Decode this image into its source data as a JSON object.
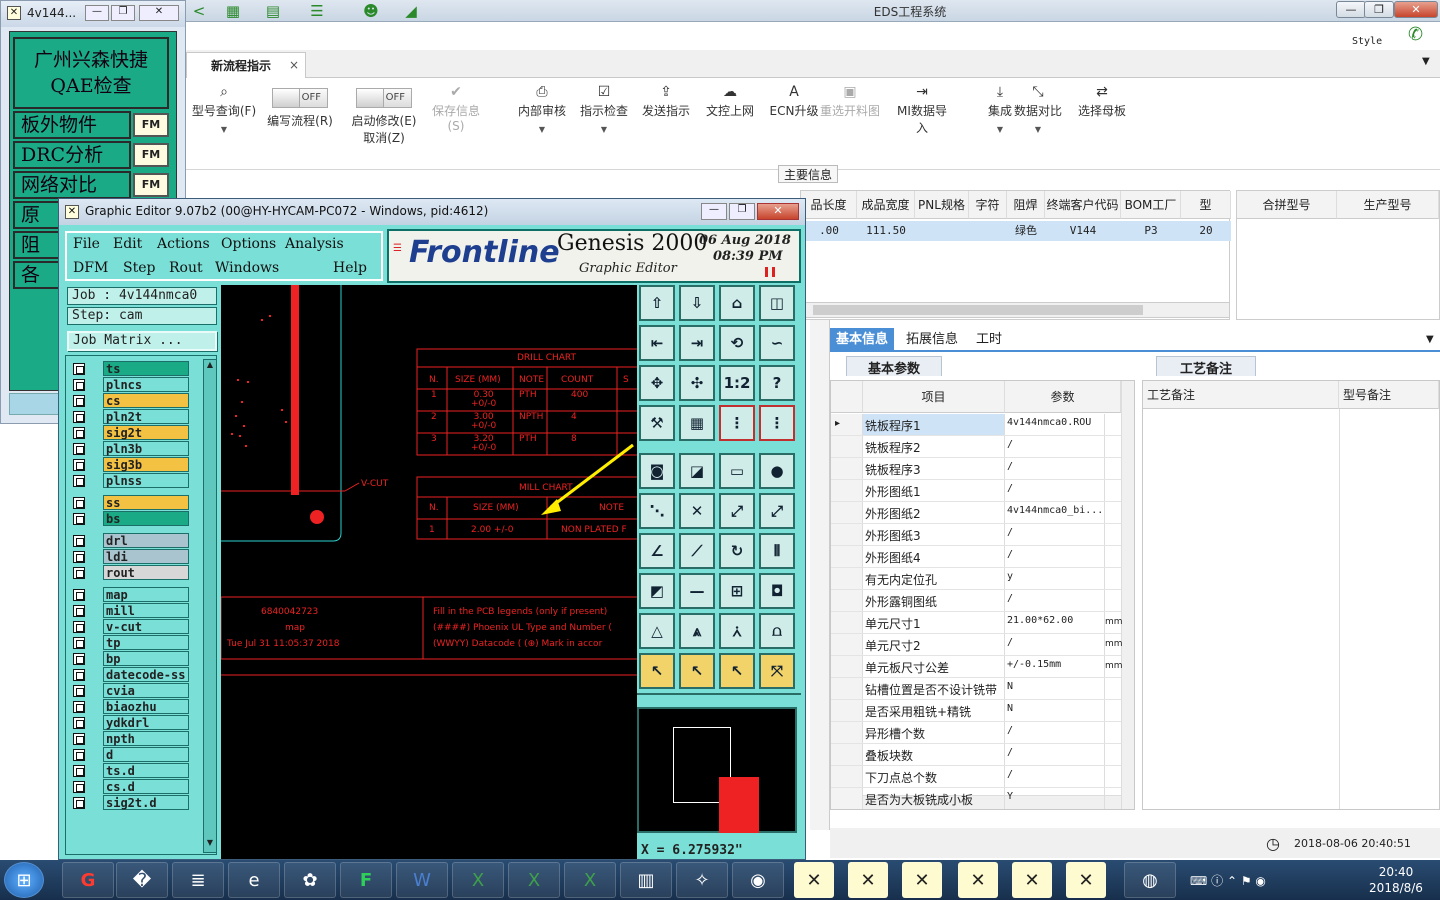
{
  "eds": {
    "title": "EDS工程系统",
    "style_label": "Style",
    "tab_label": "新流程指示",
    "tab_close": "×",
    "ribbon": [
      {
        "icon": "search-icon",
        "glyph": "⌕",
        "label": "型号查询(F)",
        "dim": false
      },
      {
        "icon": "toggle-off",
        "toggle": "OFF",
        "label": "编写流程(R)",
        "dim": false
      },
      {
        "icon": "toggle-off",
        "toggle": "OFF",
        "label": "启动修改(E)\n取消(Z)",
        "dim": false
      },
      {
        "icon": "check-icon",
        "glyph": "✔",
        "label": "保存信息(S)",
        "dim": true
      },
      {
        "icon": "print-icon",
        "glyph": "⎙",
        "label": "内部审核",
        "dim": false
      },
      {
        "icon": "checkbox-icon",
        "glyph": "☑",
        "label": "指示检查",
        "dim": false
      },
      {
        "icon": "upload-icon",
        "glyph": "⇪",
        "label": "发送指示",
        "dim": false
      },
      {
        "icon": "cloud-upload-icon",
        "glyph": "☁",
        "label": "文控上网",
        "dim": false
      },
      {
        "icon": "letter-a-icon",
        "glyph": "A",
        "label": "ECN升级",
        "dim": false
      },
      {
        "icon": "image-icon",
        "glyph": "▣",
        "label": "重选开料图",
        "dim": true
      },
      {
        "icon": "import-icon",
        "glyph": "⇥",
        "label": "MI数据导入",
        "dim": false
      },
      {
        "icon": "download-icon",
        "glyph": "⤓",
        "label": "集成",
        "dim": false
      },
      {
        "icon": "compare-icon",
        "glyph": "⤡",
        "label": "数据对比",
        "dim": false
      },
      {
        "icon": "shuffle-icon",
        "glyph": "⇄",
        "label": "选择母板",
        "dim": false
      }
    ],
    "main_info_label": "主要信息",
    "grid1": {
      "headers": [
        "品长度",
        "成品宽度",
        "PNL规格",
        "字符",
        "阻焊",
        "终端客户代码",
        "BOM工厂",
        "型"
      ],
      "row": [
        ".00",
        "111.50",
        "",
        "",
        "绿色",
        "V144",
        "P3",
        "20"
      ]
    },
    "grid2_headers": [
      "合拼型号",
      "生产型号"
    ],
    "lower_tabs": [
      "基本信息",
      "拓展信息",
      "工时"
    ],
    "basic_params_tab": "基本参数",
    "craft_notes_tab": "工艺备注",
    "param_headers": [
      "项目",
      "参数"
    ],
    "params": [
      {
        "item": "铣板程序1",
        "value": "4v144nmca0.ROU",
        "unit": ""
      },
      {
        "item": "铣板程序2",
        "value": "/",
        "unit": ""
      },
      {
        "item": "铣板程序3",
        "value": "/",
        "unit": ""
      },
      {
        "item": "外形图纸1",
        "value": "/",
        "unit": ""
      },
      {
        "item": "外形图纸2",
        "value": "4v144nmca0_bi...",
        "unit": ""
      },
      {
        "item": "外形图纸3",
        "value": "/",
        "unit": ""
      },
      {
        "item": "外形图纸4",
        "value": "/",
        "unit": ""
      },
      {
        "item": "有无内定位孔",
        "value": "y",
        "unit": ""
      },
      {
        "item": "外形露铜图纸",
        "value": "/",
        "unit": ""
      },
      {
        "item": "单元尺寸1",
        "value": "21.00*62.00",
        "unit": "mm"
      },
      {
        "item": "单元尺寸2",
        "value": "/",
        "unit": "mm"
      },
      {
        "item": "单元板尺寸公差",
        "value": "+/-0.15mm",
        "unit": "mm"
      },
      {
        "item": "钻槽位置是否不设计铣带",
        "value": "N",
        "unit": ""
      },
      {
        "item": "是否采用粗铣+精铣",
        "value": "N",
        "unit": ""
      },
      {
        "item": "异形槽个数",
        "value": "/",
        "unit": ""
      },
      {
        "item": "叠板块数",
        "value": "/",
        "unit": ""
      },
      {
        "item": "下刀点总个数",
        "value": "/",
        "unit": ""
      },
      {
        "item": "是否为大板铣成小板",
        "value": "Y",
        "unit": ""
      }
    ],
    "memo_headers": [
      "工艺备注",
      "型号备注"
    ],
    "status_time": "2018-08-06 20:40:51"
  },
  "qae": {
    "title": "4v144...",
    "heading": "广州兴森快捷\nQAE检查",
    "buttons": [
      {
        "label": "板外物件",
        "fm": "FM"
      },
      {
        "label": "DRC分析",
        "fm": "FM"
      },
      {
        "label": "网络对比",
        "fm": "FM"
      },
      {
        "label": "原",
        "fm": ""
      },
      {
        "label": "阻",
        "fm": ""
      },
      {
        "label": "各",
        "fm": ""
      }
    ]
  },
  "genesis": {
    "title": "Graphic Editor 9.07b2 (00@HY-HYCAM-PC072 - Windows, pid:4612)",
    "menu_row1": [
      "File",
      "Edit",
      "Actions",
      "Options",
      "Analysis"
    ],
    "menu_row2": [
      "DFM",
      "Step",
      "Rout",
      "Windows",
      "Help"
    ],
    "brand": "Frontline",
    "product": "Genesis 2000",
    "subtitle": "Graphic Editor",
    "date": "06 Aug 2018",
    "time": "08:39 PM",
    "job": "Job : 4v144nmca0",
    "step": "Step: cam",
    "job_matrix": "Job Matrix ...",
    "layers": [
      {
        "name": "ts",
        "color": "#1aaa86"
      },
      {
        "name": "plncs",
        "color": "#7adfd6"
      },
      {
        "name": "cs",
        "color": "#f4c242"
      },
      {
        "name": "pln2t",
        "color": "#7adfd6"
      },
      {
        "name": "sig2t",
        "color": "#f4c242"
      },
      {
        "name": "pln3b",
        "color": "#7adfd6"
      },
      {
        "name": "sig3b",
        "color": "#f4c242"
      },
      {
        "name": "plnss",
        "color": "#7adfd6"
      },
      {
        "name": "ss",
        "color": "#f4c242"
      },
      {
        "name": "bs",
        "color": "#1aaa86"
      },
      {
        "name": "drl",
        "color": "#a9c4cf"
      },
      {
        "name": "ldi",
        "color": "#a9c4cf"
      },
      {
        "name": "rout",
        "color": "#d7d7d7"
      },
      {
        "name": "map",
        "color": "#7adfd6"
      },
      {
        "name": "mill",
        "color": "#7adfd6"
      },
      {
        "name": "v-cut",
        "color": "#7adfd6"
      },
      {
        "name": "tp",
        "color": "#7adfd6"
      },
      {
        "name": "bp",
        "color": "#7adfd6"
      },
      {
        "name": "datecode-ss",
        "color": "#7adfd6"
      },
      {
        "name": "cvia",
        "color": "#7adfd6"
      },
      {
        "name": "biaozhu",
        "color": "#7adfd6"
      },
      {
        "name": "ydkdrl",
        "color": "#7adfd6"
      },
      {
        "name": "npth",
        "color": "#7adfd6"
      },
      {
        "name": "d",
        "color": "#7adfd6"
      },
      {
        "name": "ts.d",
        "color": "#7adfd6"
      },
      {
        "name": "cs.d",
        "color": "#7adfd6"
      },
      {
        "name": "sig2t.d",
        "color": "#7adfd6"
      }
    ],
    "canvas": {
      "drill_chart_title": "DRILL CHART",
      "drill_headers": [
        "N.",
        "SIZE (MM)",
        "NOTE",
        "COUNT",
        "S"
      ],
      "drill_rows": [
        [
          "1",
          "0.30\n+0/-0",
          "PTH",
          "400"
        ],
        [
          "2",
          "3.00\n+0/-0",
          "NPTH",
          "4"
        ],
        [
          "3",
          "3.20\n+0/-0",
          "PTH",
          "8"
        ]
      ],
      "mill_chart_title": "MILL CHART",
      "mill_headers": [
        "N.",
        "SIZE (MM)",
        "NOTE"
      ],
      "mill_row": [
        "1",
        "2.00 +/-0",
        "NON PLATED F"
      ],
      "vcut_label": "V-CUT",
      "ref_number": "6840042723",
      "ref_layer": "map",
      "ref_date": "Tue Jul 31 11:05:37 2018",
      "legend_note1": "Fill in the PCB legends (only if present)",
      "legend_note2": "(####) Phoenix UL Type and Number (",
      "legend_note3": "(WWYY) Datacode ( (⊕) Mark in accor"
    },
    "coord": "X = 6.275932\""
  },
  "taskbar": {
    "time": "20:40",
    "date": "2018/8/6",
    "apps": [
      "start",
      "genesis",
      "save",
      "scroll",
      "ie",
      "shell",
      "frontline",
      "word",
      "excel",
      "excel",
      "excel",
      "winrar",
      "network",
      "eye",
      "x",
      "x",
      "x",
      "x",
      "x",
      "x",
      "globe"
    ]
  }
}
